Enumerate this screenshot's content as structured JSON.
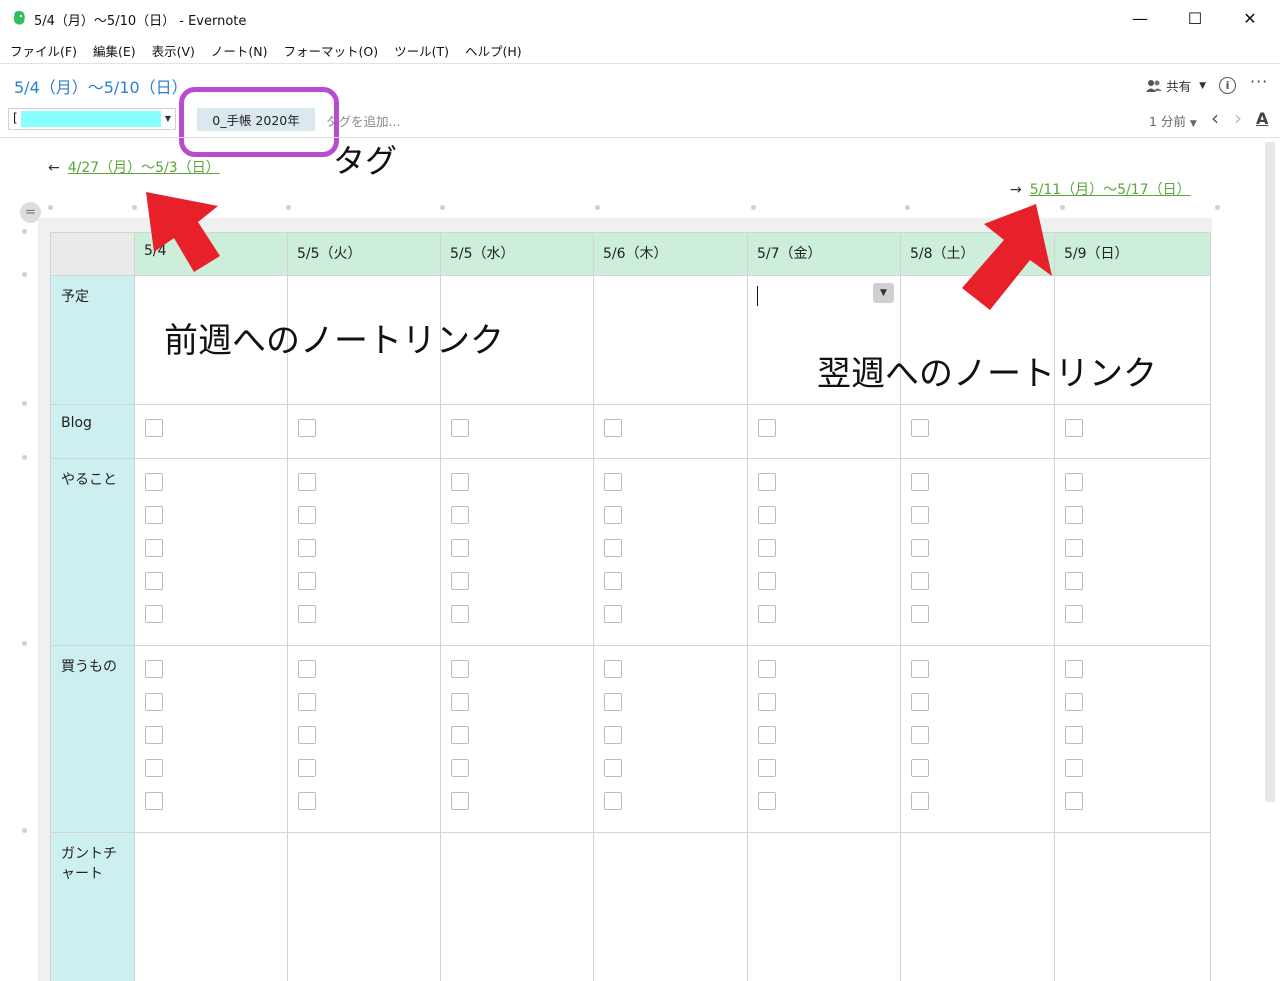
{
  "window": {
    "title": "5/4（月）～5/10（日） - Evernote",
    "controls": {
      "minimize": "—",
      "maximize": "☐",
      "close": "✕"
    }
  },
  "menu": [
    "ファイル(F)",
    "編集(E)",
    "表示(V)",
    "ノート(N)",
    "フォーマット(O)",
    "ツール(T)",
    "ヘルプ(H)"
  ],
  "note": {
    "title": "5/4（月）～5/10（日）",
    "share_label": "共有",
    "notebook_mark": "[",
    "tag": "0_手帳 2020年",
    "tag_placeholder": "タグを追加...",
    "updated": "1 分前",
    "font_icon": "A"
  },
  "links": {
    "prev_arrow": "←",
    "prev_label": "4/27（月）～5/3（日）",
    "next_arrow": "→",
    "next_label": "5/11（月）～5/17（日）"
  },
  "table": {
    "columns": [
      "5/4",
      "5/5（火）",
      "5/5（水）",
      "5/6（木）",
      "5/7（金）",
      "5/8（土）",
      "5/9（日）"
    ],
    "rows": [
      {
        "label": "予定",
        "checkboxes": 0
      },
      {
        "label": "Blog",
        "checkboxes": 1
      },
      {
        "label": "やること",
        "checkboxes": 5
      },
      {
        "label": "買うもの",
        "checkboxes": 5
      },
      {
        "label": "ガントチャート",
        "checkboxes": 0
      }
    ]
  },
  "annotations": {
    "tag_note": "タグ",
    "prev_note": "前週へのノートリンク",
    "next_note": "翌週へのノートリンク"
  },
  "colors": {
    "title_blue": "#2b7fd0",
    "link_green": "#5aa63a",
    "header_green": "#cdeed9",
    "label_cyan": "#cdeff0",
    "highlight_purple": "#b74ccf",
    "arrow_red": "#e8202a"
  }
}
